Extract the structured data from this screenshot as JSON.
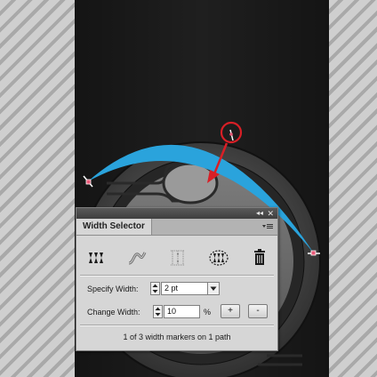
{
  "panel": {
    "tab_title": "Width Selector",
    "collapse_glyph": "◂◂",
    "close_glyph": "✕",
    "tools": [
      {
        "name": "width-point-icon"
      },
      {
        "name": "stroke-curve-icon"
      },
      {
        "name": "adjust-width-icon"
      },
      {
        "name": "select-markers-icon"
      },
      {
        "name": "trash-icon"
      }
    ],
    "specify_width": {
      "label": "Specify Width:",
      "value": "2 pt"
    },
    "change_width": {
      "label": "Change Width:",
      "value": "10",
      "unit": "%",
      "plus_label": "+",
      "minus_label": "-"
    },
    "status_text": "1 of 3 width markers on 1 path"
  },
  "colors": {
    "accent_stroke": "#2aa3dc",
    "annotation": "#d81f26",
    "dark_band": "#1f1f1f"
  }
}
